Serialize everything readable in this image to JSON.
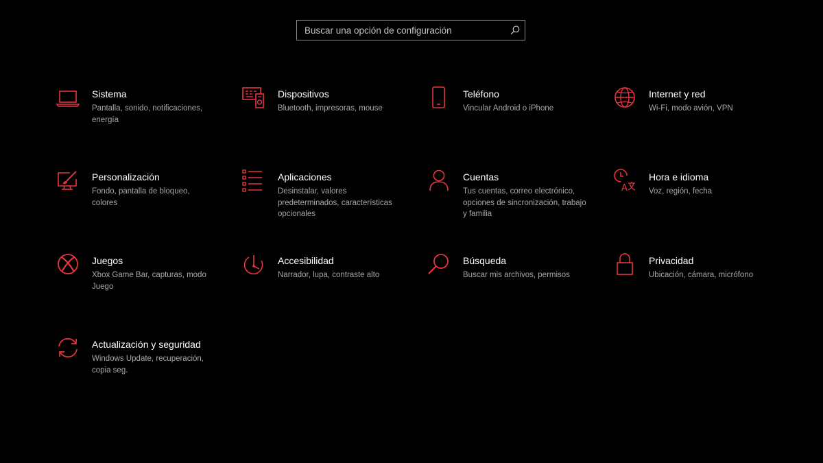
{
  "search": {
    "placeholder": "Buscar una opción de configuración",
    "icon": "search-icon"
  },
  "accent_color": "#e8343f",
  "tiles": [
    {
      "title": "Sistema",
      "desc": "Pantalla, sonido, notificaciones, energía",
      "icon": "laptop-icon"
    },
    {
      "title": "Dispositivos",
      "desc": "Bluetooth, impresoras, mouse",
      "icon": "devices-icon"
    },
    {
      "title": "Teléfono",
      "desc": "Vincular Android o iPhone",
      "icon": "phone-icon"
    },
    {
      "title": "Internet y red",
      "desc": "Wi-Fi, modo avión, VPN",
      "icon": "globe-icon"
    },
    {
      "title": "Personalización",
      "desc": "Fondo, pantalla de bloqueo, colores",
      "icon": "paint-icon"
    },
    {
      "title": "Aplicaciones",
      "desc": "Desinstalar, valores predeterminados, características opcionales",
      "icon": "apps-list-icon"
    },
    {
      "title": "Cuentas",
      "desc": "Tus cuentas, correo electrónico, opciones de sincronización, trabajo y familia",
      "icon": "person-icon"
    },
    {
      "title": "Hora e idioma",
      "desc": "Voz, región, fecha",
      "icon": "time-language-icon"
    },
    {
      "title": "Juegos",
      "desc": "Xbox Game Bar, capturas, modo Juego",
      "icon": "xbox-icon"
    },
    {
      "title": "Accesibilidad",
      "desc": "Narrador, lupa, contraste alto",
      "icon": "accessibility-icon"
    },
    {
      "title": "Búsqueda",
      "desc": "Buscar mis archivos, permisos",
      "icon": "search-icon"
    },
    {
      "title": "Privacidad",
      "desc": "Ubicación, cámara, micrófono",
      "icon": "lock-icon"
    },
    {
      "title": "Actualización y seguridad",
      "desc": "Windows Update, recuperación, copia seg.",
      "icon": "update-icon"
    }
  ]
}
